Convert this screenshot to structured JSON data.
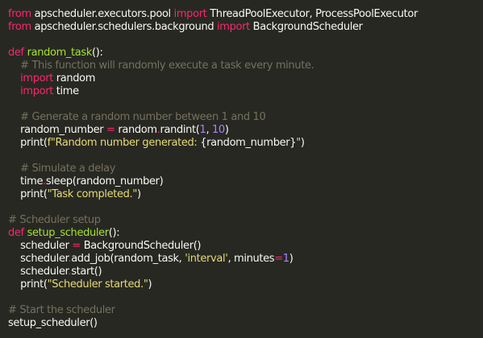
{
  "theme": {
    "background": "#272822",
    "foreground": "#f8f8f2",
    "keyword": "#f92672",
    "function": "#a6e22e",
    "string": "#e6db74",
    "number": "#ae81ff",
    "comment": "#75715e"
  },
  "code": {
    "lines": [
      [
        {
          "t": "kw",
          "v": "from"
        },
        {
          "t": "pl",
          "v": " apscheduler.executors.pool "
        },
        {
          "t": "kw",
          "v": "import"
        },
        {
          "t": "pl",
          "v": " ThreadPoolExecutor, ProcessPoolExecutor"
        }
      ],
      [
        {
          "t": "kw",
          "v": "from"
        },
        {
          "t": "pl",
          "v": " apscheduler.schedulers.background "
        },
        {
          "t": "kw",
          "v": "import"
        },
        {
          "t": "pl",
          "v": " BackgroundScheduler"
        }
      ],
      [],
      [
        {
          "t": "kw",
          "v": "def"
        },
        {
          "t": "pl",
          "v": " "
        },
        {
          "t": "fn",
          "v": "random_task"
        },
        {
          "t": "pl",
          "v": "():"
        }
      ],
      [
        {
          "t": "pl",
          "v": "    "
        },
        {
          "t": "cm",
          "v": "# This function will randomly execute a task every minute."
        }
      ],
      [
        {
          "t": "pl",
          "v": "    "
        },
        {
          "t": "kw",
          "v": "import"
        },
        {
          "t": "pl",
          "v": " random"
        }
      ],
      [
        {
          "t": "pl",
          "v": "    "
        },
        {
          "t": "kw",
          "v": "import"
        },
        {
          "t": "pl",
          "v": " time"
        }
      ],
      [],
      [
        {
          "t": "pl",
          "v": "    "
        },
        {
          "t": "cm",
          "v": "# Generate a random number between 1 and 10"
        }
      ],
      [
        {
          "t": "pl",
          "v": "    random_number "
        },
        {
          "t": "op",
          "v": "="
        },
        {
          "t": "pl",
          "v": " random"
        },
        {
          "t": "op",
          "v": "."
        },
        {
          "t": "pl",
          "v": "randint("
        },
        {
          "t": "num",
          "v": "1"
        },
        {
          "t": "pl",
          "v": ", "
        },
        {
          "t": "num",
          "v": "10"
        },
        {
          "t": "pl",
          "v": ")"
        }
      ],
      [
        {
          "t": "pl",
          "v": "    print("
        },
        {
          "t": "str",
          "v": "f\"Random number generated: "
        },
        {
          "t": "pl",
          "v": "{random_number}"
        },
        {
          "t": "str",
          "v": "\""
        },
        {
          "t": "pl",
          "v": ")"
        }
      ],
      [],
      [
        {
          "t": "pl",
          "v": "    "
        },
        {
          "t": "cm",
          "v": "# Simulate a delay"
        }
      ],
      [
        {
          "t": "pl",
          "v": "    time"
        },
        {
          "t": "op",
          "v": "."
        },
        {
          "t": "pl",
          "v": "sleep(random_number)"
        }
      ],
      [
        {
          "t": "pl",
          "v": "    print("
        },
        {
          "t": "str",
          "v": "\"Task completed.\""
        },
        {
          "t": "pl",
          "v": ")"
        }
      ],
      [],
      [
        {
          "t": "cm",
          "v": "# Scheduler setup"
        }
      ],
      [
        {
          "t": "kw",
          "v": "def"
        },
        {
          "t": "pl",
          "v": " "
        },
        {
          "t": "fn",
          "v": "setup_scheduler"
        },
        {
          "t": "pl",
          "v": "():"
        }
      ],
      [
        {
          "t": "pl",
          "v": "    scheduler "
        },
        {
          "t": "op",
          "v": "="
        },
        {
          "t": "pl",
          "v": " BackgroundScheduler()"
        }
      ],
      [
        {
          "t": "pl",
          "v": "    scheduler"
        },
        {
          "t": "op",
          "v": "."
        },
        {
          "t": "pl",
          "v": "add_job(random_task, "
        },
        {
          "t": "str",
          "v": "'interval'"
        },
        {
          "t": "pl",
          "v": ", minutes"
        },
        {
          "t": "op",
          "v": "="
        },
        {
          "t": "num",
          "v": "1"
        },
        {
          "t": "pl",
          "v": ")"
        }
      ],
      [
        {
          "t": "pl",
          "v": "    scheduler"
        },
        {
          "t": "op",
          "v": "."
        },
        {
          "t": "pl",
          "v": "start()"
        }
      ],
      [
        {
          "t": "pl",
          "v": "    print("
        },
        {
          "t": "str",
          "v": "\"Scheduler started.\""
        },
        {
          "t": "pl",
          "v": ")"
        }
      ],
      [],
      [
        {
          "t": "cm",
          "v": "# Start the scheduler"
        }
      ],
      [
        {
          "t": "pl",
          "v": "setup_scheduler()"
        }
      ]
    ]
  }
}
